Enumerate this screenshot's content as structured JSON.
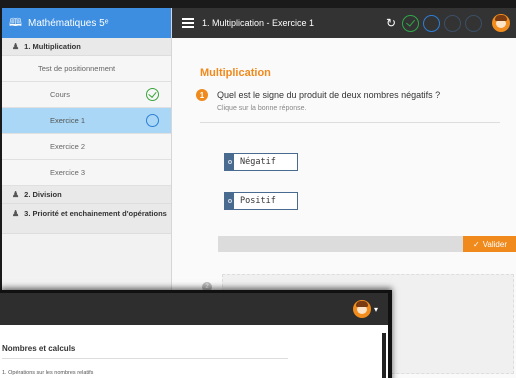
{
  "sidebar": {
    "course_title": "Mathématiques 5ᵉ",
    "sections": [
      {
        "label": "1. Multiplication"
      },
      {
        "label": "2. Division"
      },
      {
        "label": "3. Priorité et enchainement d'opérations"
      }
    ],
    "items": [
      {
        "label": "Test de positionnement",
        "status": ""
      },
      {
        "label": "Cours",
        "status": "done"
      },
      {
        "label": "Exercice 1",
        "status": "current"
      },
      {
        "label": "Exercice 2",
        "status": ""
      },
      {
        "label": "Exercice 3",
        "status": ""
      }
    ]
  },
  "topbar": {
    "title": "1. Multiplication - Exercice 1",
    "progress": [
      "done",
      "current",
      "todo",
      "todo"
    ]
  },
  "content": {
    "heading": "Multiplication",
    "question_number": "1",
    "question": "Quel est le signe du produit de deux nombres négatifs ?",
    "hint": "Clique sur la bonne réponse.",
    "options": [
      "Négatif",
      "Positif"
    ],
    "validate_label": "Valider",
    "question2_number": "2"
  },
  "overlay": {
    "title": "Nombres et calculs",
    "item": "1. Opérations sur les nombres relatifs"
  },
  "colors": {
    "accent": "#f08a1c",
    "header_blue": "#3d8ee0",
    "active_item": "#a9d7f5",
    "done_green": "#3aa53a"
  }
}
